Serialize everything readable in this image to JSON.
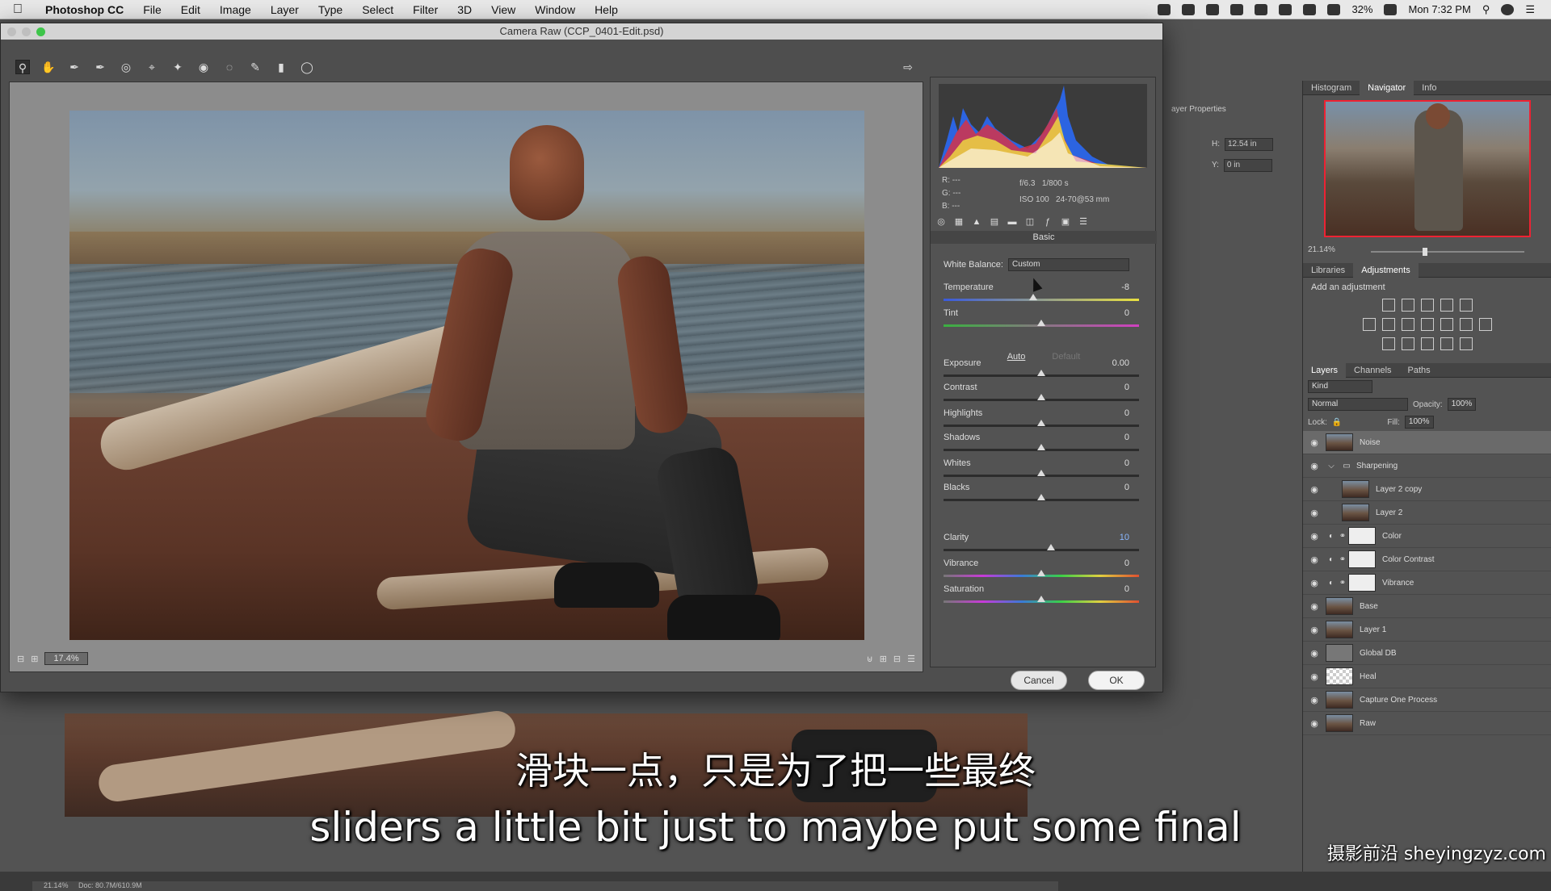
{
  "menubar": {
    "app": "Photoshop CC",
    "items": [
      "File",
      "Edit",
      "Image",
      "Layer",
      "Type",
      "Select",
      "Filter",
      "3D",
      "View",
      "Window",
      "Help"
    ],
    "battery": "32%",
    "clock": "Mon 7:32 PM"
  },
  "dialog": {
    "title": "Camera Raw (CCP_0401-Edit.psd)",
    "zoom": "17.4%",
    "cancel_label": "Cancel",
    "ok_label": "OK"
  },
  "info": {
    "r": "R:   ---",
    "g": "G:   ---",
    "b": "B:   ---",
    "aperture": "f/6.3",
    "shutter": "1/800 s",
    "iso": "ISO 100",
    "lens": "24-70@53 mm"
  },
  "basic": {
    "panel_title": "Basic",
    "white_balance_label": "White Balance:",
    "white_balance_value": "Custom",
    "auto_label": "Auto",
    "default_label": "Default",
    "sliders": [
      {
        "label": "Temperature",
        "value": "-8",
        "pos": 0.46
      },
      {
        "label": "Tint",
        "value": "0",
        "pos": 0.5
      },
      {
        "label": "Exposure",
        "value": "0.00",
        "pos": 0.5
      },
      {
        "label": "Contrast",
        "value": "0",
        "pos": 0.5
      },
      {
        "label": "Highlights",
        "value": "0",
        "pos": 0.5
      },
      {
        "label": "Shadows",
        "value": "0",
        "pos": 0.5
      },
      {
        "label": "Whites",
        "value": "0",
        "pos": 0.5
      },
      {
        "label": "Blacks",
        "value": "0",
        "pos": 0.5
      },
      {
        "label": "Clarity",
        "value": "10",
        "pos": 0.55
      },
      {
        "label": "Vibrance",
        "value": "0",
        "pos": 0.5
      },
      {
        "label": "Saturation",
        "value": "0",
        "pos": 0.5
      }
    ]
  },
  "properties": {
    "title": "ayer Properties",
    "h_label": "H:",
    "h_value": "12.54 in",
    "y_label": "Y:",
    "y_value": "0 in"
  },
  "navigator": {
    "tabs": [
      "Histogram",
      "Navigator",
      "Info"
    ],
    "zoom": "21.14%"
  },
  "adjustments": {
    "tabs": [
      "Libraries",
      "Adjustments"
    ],
    "add_label": "Add an adjustment"
  },
  "layers": {
    "tabs": [
      "Layers",
      "Channels",
      "Paths"
    ],
    "kind": "Kind",
    "blend": "Normal",
    "opacity_label": "Opacity:",
    "opacity": "100%",
    "lock_label": "Lock:",
    "fill_label": "Fill:",
    "fill": "100%",
    "items": [
      {
        "name": "Noise",
        "thumb": "photo",
        "selected": true
      },
      {
        "name": "Sharpening",
        "thumb": "folder",
        "group": true
      },
      {
        "name": "Layer 2 copy",
        "thumb": "photo",
        "indent": true
      },
      {
        "name": "Layer 2",
        "thumb": "photo",
        "indent": true
      },
      {
        "name": "Color",
        "thumb": "white",
        "adj": true
      },
      {
        "name": "Color Contrast",
        "thumb": "white",
        "adj": true
      },
      {
        "name": "Vibrance",
        "thumb": "white",
        "adj": true
      },
      {
        "name": "Base",
        "thumb": "photo"
      },
      {
        "name": "Layer 1",
        "thumb": "photo"
      },
      {
        "name": "Global DB",
        "thumb": "gray"
      },
      {
        "name": "Heal",
        "thumb": "checker"
      },
      {
        "name": "Capture One Process",
        "thumb": "photo"
      },
      {
        "name": "Raw",
        "thumb": "photo"
      }
    ]
  },
  "ps_status": "21.14%",
  "ps_status_doc": "Doc: 80.7M/610.9M",
  "subtitles": {
    "cn": "滑块一点，只是为了把一些最终",
    "en": "sliders a little bit just to maybe put some final"
  },
  "watermark": "摄影前沿 sheyingzyz.com"
}
